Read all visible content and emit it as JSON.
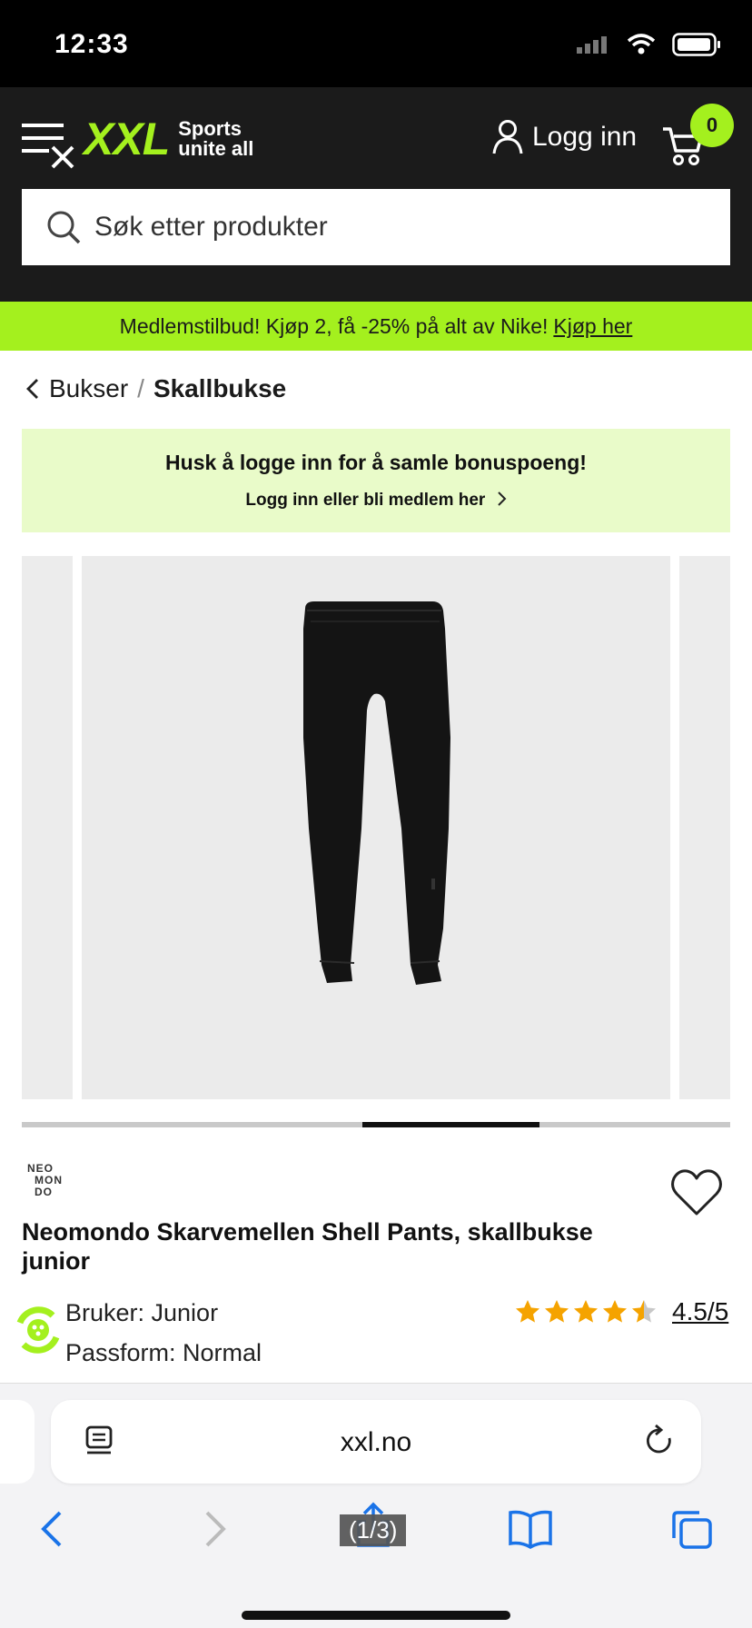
{
  "status_bar": {
    "time": "12:33"
  },
  "header": {
    "logo_text": "XXL",
    "logo_tagline_1": "Sports",
    "logo_tagline_2": "unite all",
    "login_label": "Logg inn",
    "cart_count": "0",
    "search_placeholder": "Søk etter produkter"
  },
  "promo": {
    "text": "Medlemstilbud! Kjøp 2, få -25% på alt av Nike!",
    "link": "Kjøp her"
  },
  "breadcrumb": {
    "parent": "Bukser",
    "separator": "/",
    "current": "Skallbukse"
  },
  "login_banner": {
    "title": "Husk å logge inn for å samle bonuspoeng!",
    "link": "Logg inn eller bli medlem her"
  },
  "gallery": {
    "images_total": 3,
    "current_image": 2
  },
  "product": {
    "brand_logo_lines": [
      "NEO",
      "MON",
      "DO"
    ],
    "title": "Neomondo Skarvemellen Shell Pants, skallbukse junior",
    "attribute_1": "Bruker: Junior",
    "attribute_2": "Passform: Normal",
    "rating": 4.5,
    "rating_text": "4.5/5"
  },
  "browser": {
    "url": "xxl.no",
    "page_counter": "(1/3)"
  },
  "colors": {
    "brand_green": "#a4f01e",
    "header_bg": "#1b1b1b",
    "banner_bg": "#e9fbc9"
  }
}
